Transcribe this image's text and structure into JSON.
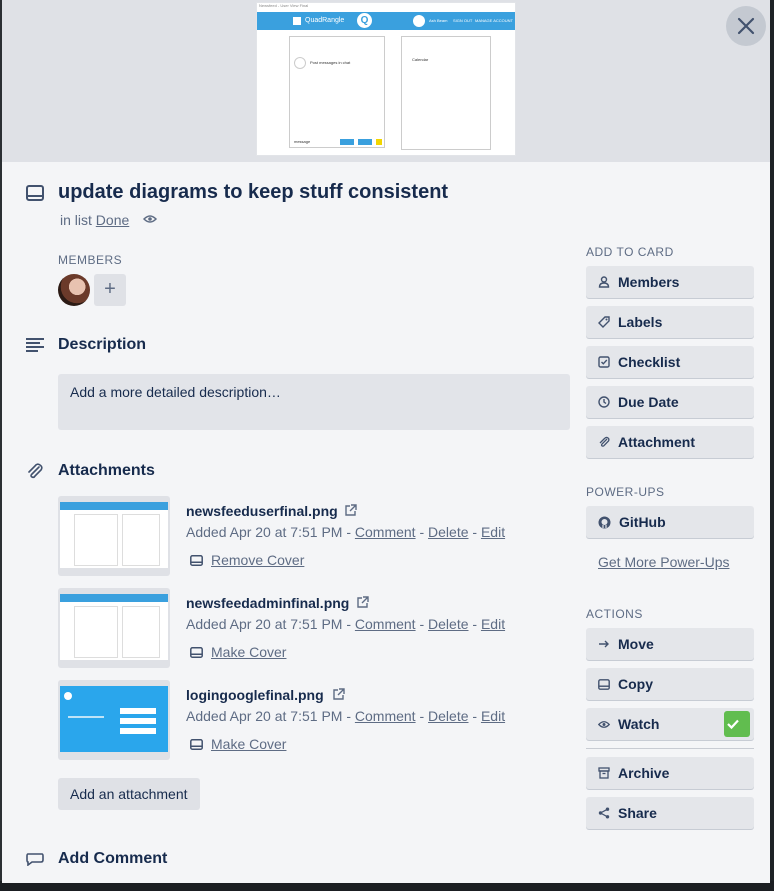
{
  "cover": {
    "caption": "Newsfeed - User View Final",
    "logo_text": "QuadRangle",
    "logo_q": "Q",
    "nav": [
      "Ash Beam",
      "SIGN OUT",
      "MANAGE ACCOUNT"
    ],
    "panel_left_text": "Post messages in chat",
    "panel_right_text": "Calendar",
    "input_text": "message"
  },
  "card": {
    "title": "update diagrams to keep stuff consistent",
    "in_list_prefix": "in list",
    "list_name": "Done"
  },
  "members": {
    "label": "MEMBERS",
    "add_symbol": "+"
  },
  "description": {
    "title": "Description",
    "placeholder": "Add a more detailed description…"
  },
  "attachments": {
    "title": "Attachments",
    "items": [
      {
        "name": "newsfeeduserfinal.png",
        "added": "Added Apr 20 at 7:51 PM - ",
        "comment": "Comment",
        "sep1": " - ",
        "delete": "Delete",
        "sep2": " - ",
        "edit": "Edit",
        "cover_action": "Remove Cover"
      },
      {
        "name": "newsfeedadminfinal.png",
        "added": "Added Apr 20 at 7:51 PM - ",
        "comment": "Comment",
        "sep1": " - ",
        "delete": "Delete",
        "sep2": " - ",
        "edit": "Edit",
        "cover_action": "Make Cover"
      },
      {
        "name": "logingooglefinal.png",
        "added": "Added Apr 20 at 7:51 PM - ",
        "comment": "Comment",
        "sep1": " - ",
        "delete": "Delete",
        "sep2": " - ",
        "edit": "Edit",
        "cover_action": "Make Cover"
      }
    ],
    "add_button": "Add an attachment"
  },
  "comment": {
    "title": "Add Comment"
  },
  "sidebar": {
    "add_to_card_label": "ADD TO CARD",
    "add_to_card": [
      "Members",
      "Labels",
      "Checklist",
      "Due Date",
      "Attachment"
    ],
    "powerups_label": "POWER-UPS",
    "github": "GitHub",
    "get_more": "Get More Power-Ups",
    "actions_label": "ACTIONS",
    "actions": [
      "Move",
      "Copy",
      "Watch"
    ],
    "archive": "Archive",
    "share": "Share"
  },
  "colors": {
    "accent_blue": "#3aa0de",
    "watch_green": "#61bd4f"
  }
}
